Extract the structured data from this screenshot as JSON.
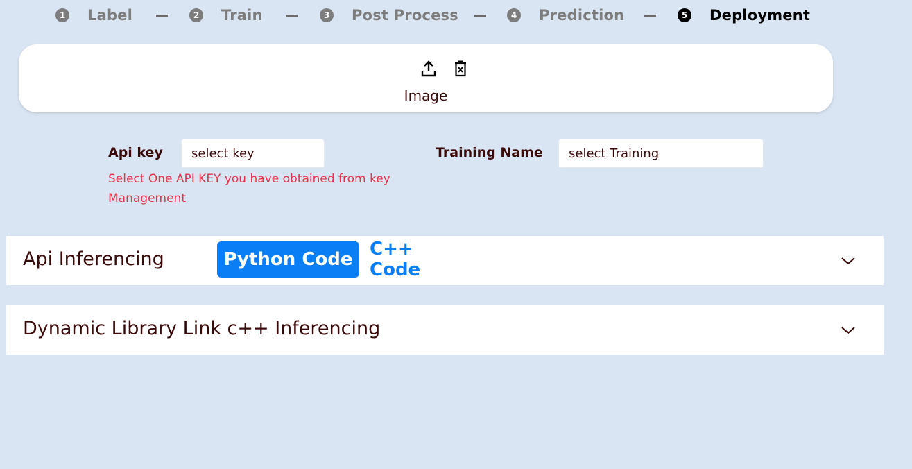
{
  "stepper": {
    "steps": [
      {
        "num": "1",
        "label": "Label"
      },
      {
        "num": "2",
        "label": "Train"
      },
      {
        "num": "3",
        "label": "Post Process"
      },
      {
        "num": "4",
        "label": "Prediction"
      },
      {
        "num": "5",
        "label": "Deployment"
      }
    ],
    "active_step": "Deployment"
  },
  "upload": {
    "label": "Image",
    "upload_icon": "upload-icon",
    "delete_icon": "delete-icon"
  },
  "form": {
    "api_key_label": "Api key",
    "api_key_value": "select key",
    "api_key_help": "Select One API KEY you have obtained from key Management",
    "training_label": "Training Name",
    "training_value": "select Training"
  },
  "accordions": [
    {
      "title": "Api Inferencing",
      "tabs": [
        {
          "label": "Python Code",
          "active": true
        },
        {
          "label": "C++ Code",
          "active": false
        }
      ]
    },
    {
      "title": "Dynamic Library Link c++ Inferencing"
    }
  ],
  "colors": {
    "background": "#dae5f3",
    "accent": "#0a7ff5",
    "error_text": "#e8334a",
    "step_inactive": "#7d7d7d"
  }
}
